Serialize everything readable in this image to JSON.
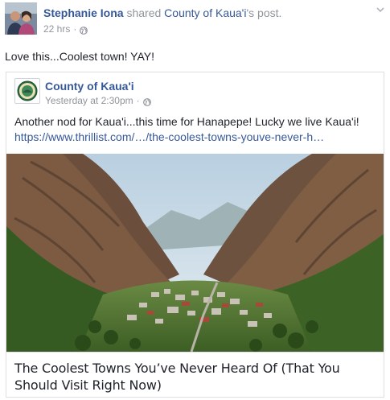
{
  "post": {
    "sharer_name": "Stephanie Iona",
    "action_text": "shared",
    "shared_page_name": "County of Kaua'i",
    "shared_suffix": "'s post.",
    "time": "22 hrs",
    "separator": "·",
    "privacy_icon": "globe-icon",
    "menu_icon": "chevron-down-icon",
    "message": "Love this...Coolest town! YAY!"
  },
  "shared_post": {
    "page_name": "County of Kaua'i",
    "time": "Yesterday at 2:30pm",
    "separator": "·",
    "privacy_icon": "globe-icon",
    "logo_icon": "county-seal-icon",
    "text": "Another nod for Kaua'i...this time for Hanapepe! Lucky we live Kaua'i!",
    "link_text": "https://www.thrillist.com/…/the-coolest-towns-youve-never-h…"
  },
  "link_preview": {
    "image_description_icon": "mountain-town-photo",
    "title": "The Coolest Towns You’ve Never Heard Of (That You Should Visit Right Now)"
  }
}
